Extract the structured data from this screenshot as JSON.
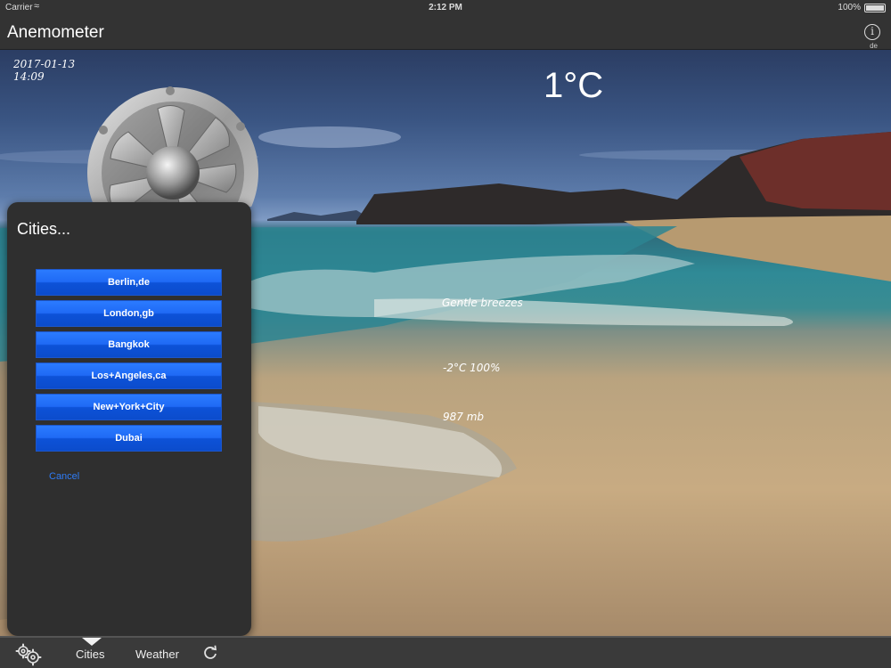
{
  "status_bar": {
    "carrier": "Carrier",
    "time": "2:12 PM",
    "battery": "100%"
  },
  "nav": {
    "title": "Anemometer",
    "info_icon": "info-icon",
    "locale": "de"
  },
  "weather": {
    "date": "2017-01-13",
    "time": "14:09",
    "temperature": "1°C",
    "wind_description": "Gentle breezes",
    "temp_humidity": "-2°C 100%",
    "pressure": "987 mb"
  },
  "cities_popover": {
    "title": "Cities...",
    "cities": [
      "Berlin,de",
      "London,gb",
      "Bangkok",
      "Los+Angeles,ca",
      "New+York+City",
      "Dubai"
    ],
    "cancel_label": "Cancel"
  },
  "tab_bar": {
    "settings_icon": "gears-icon",
    "cities_label": "Cities",
    "weather_label": "Weather",
    "refresh_icon": "refresh-icon"
  },
  "colors": {
    "bar_background": "#333333",
    "city_button": "#1f6af5",
    "cancel_link": "#2f7cf6"
  }
}
